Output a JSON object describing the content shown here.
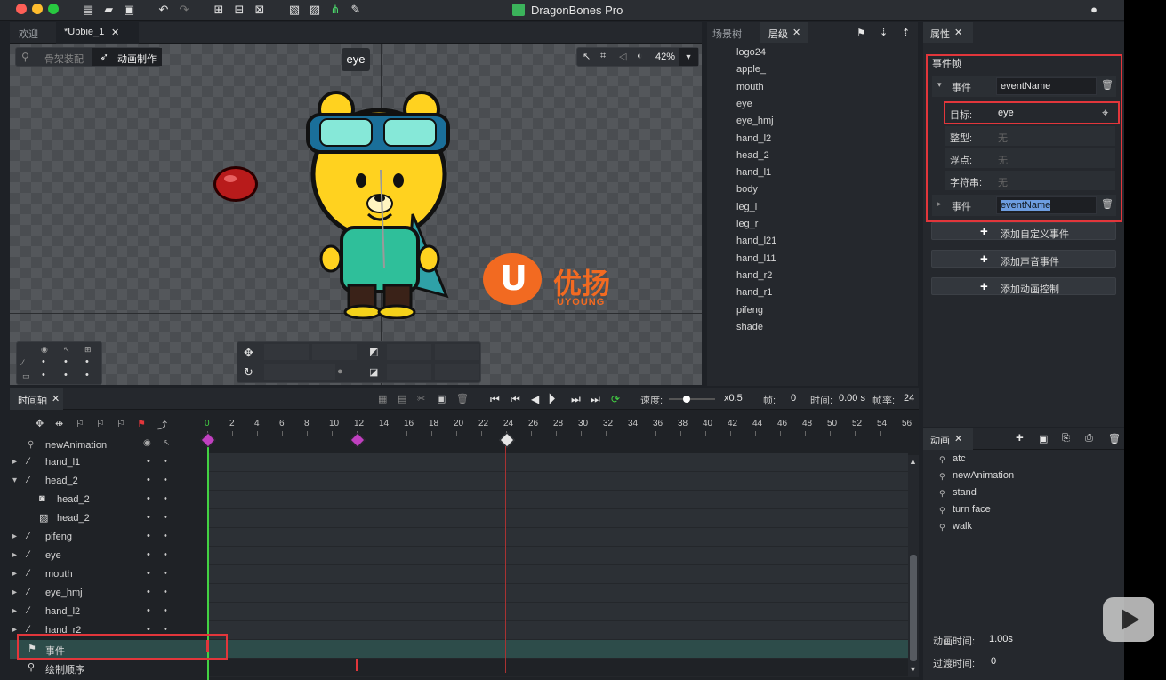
{
  "app": {
    "title": "DragonBones Pro"
  },
  "doc_tabs": {
    "welcome": "欢迎",
    "file": "*Ubbie_1"
  },
  "mode": {
    "armature": "骨架装配",
    "animate": "动画制作",
    "zoom": "42%"
  },
  "stage": {
    "tooltip": "eye",
    "brand_cn": "优扬",
    "brand_en": "UYOUNG"
  },
  "scene_panel": {
    "tab_scene": "场景树",
    "tab_layers": "层级"
  },
  "layers": [
    "logo24",
    "apple_",
    "mouth",
    "eye",
    "eye_hmj",
    "hand_l2",
    "head_2",
    "hand_l1",
    "body",
    "leg_l",
    "leg_r",
    "hand_l21",
    "hand_l11",
    "hand_r2",
    "hand_r1",
    "pifeng",
    "shade"
  ],
  "props": {
    "tab": "属性",
    "section": "事件帧",
    "event1_label": "事件",
    "event1_value": "eventName",
    "target_label": "目标:",
    "target_value": "eye",
    "int_label": "整型:",
    "int_value": "无",
    "float_label": "浮点:",
    "float_value": "无",
    "string_label": "字符串:",
    "string_value": "无",
    "event2_label": "事件",
    "event2_value": "eventName",
    "btn_custom": "添加自定义事件",
    "btn_sound": "添加声音事件",
    "btn_anim": "添加动画控制"
  },
  "timeline": {
    "tab": "时间轴",
    "speed_label": "速度:",
    "speed_value": "x0.5",
    "frame_label": "帧:",
    "frame_value": "0",
    "time_label": "时间:",
    "time_value": "0.00 s",
    "fps_label": "帧率:",
    "fps_value": "24",
    "ticks": [
      "0",
      "2",
      "4",
      "6",
      "8",
      "10",
      "12",
      "14",
      "16",
      "18",
      "20",
      "22",
      "24",
      "26",
      "28",
      "30",
      "32",
      "34",
      "36",
      "38",
      "40",
      "42",
      "44",
      "46",
      "48",
      "50",
      "52",
      "54",
      "56"
    ],
    "root": "newAnimation",
    "tracks": [
      {
        "name": "hand_l1",
        "type": "bone",
        "arrow": "▸",
        "indent": 0
      },
      {
        "name": "head_2",
        "type": "bone",
        "arrow": "▾",
        "indent": 0
      },
      {
        "name": "head_2",
        "type": "slot",
        "arrow": "",
        "indent": 1
      },
      {
        "name": "head_2",
        "type": "image",
        "arrow": "",
        "indent": 1
      },
      {
        "name": "pifeng",
        "type": "bone",
        "arrow": "▸",
        "indent": 0
      },
      {
        "name": "eye",
        "type": "bone",
        "arrow": "▸",
        "indent": 0
      },
      {
        "name": "mouth",
        "type": "bone",
        "arrow": "▸",
        "indent": 0
      },
      {
        "name": "eye_hmj",
        "type": "bone",
        "arrow": "▸",
        "indent": 0
      },
      {
        "name": "hand_l2",
        "type": "bone",
        "arrow": "▸",
        "indent": 0
      },
      {
        "name": "hand_r2",
        "type": "bone",
        "arrow": "▸",
        "indent": 0
      },
      {
        "name": "事件",
        "type": "event",
        "arrow": "",
        "indent": 0
      },
      {
        "name": "绘制顺序",
        "type": "order",
        "arrow": "",
        "indent": 0
      }
    ]
  },
  "animations": {
    "tab": "动画",
    "items": [
      "atc",
      "newAnimation",
      "stand",
      "turn face",
      "walk"
    ],
    "duration_label": "动画时间:",
    "duration_value": "1.00s",
    "transition_label": "过渡时间:",
    "transition_value": "0"
  },
  "colors": {
    "accent": "#e2363b",
    "keyframe": "#c040c0",
    "playhead": "#d43a3a",
    "green": "#43d243"
  }
}
